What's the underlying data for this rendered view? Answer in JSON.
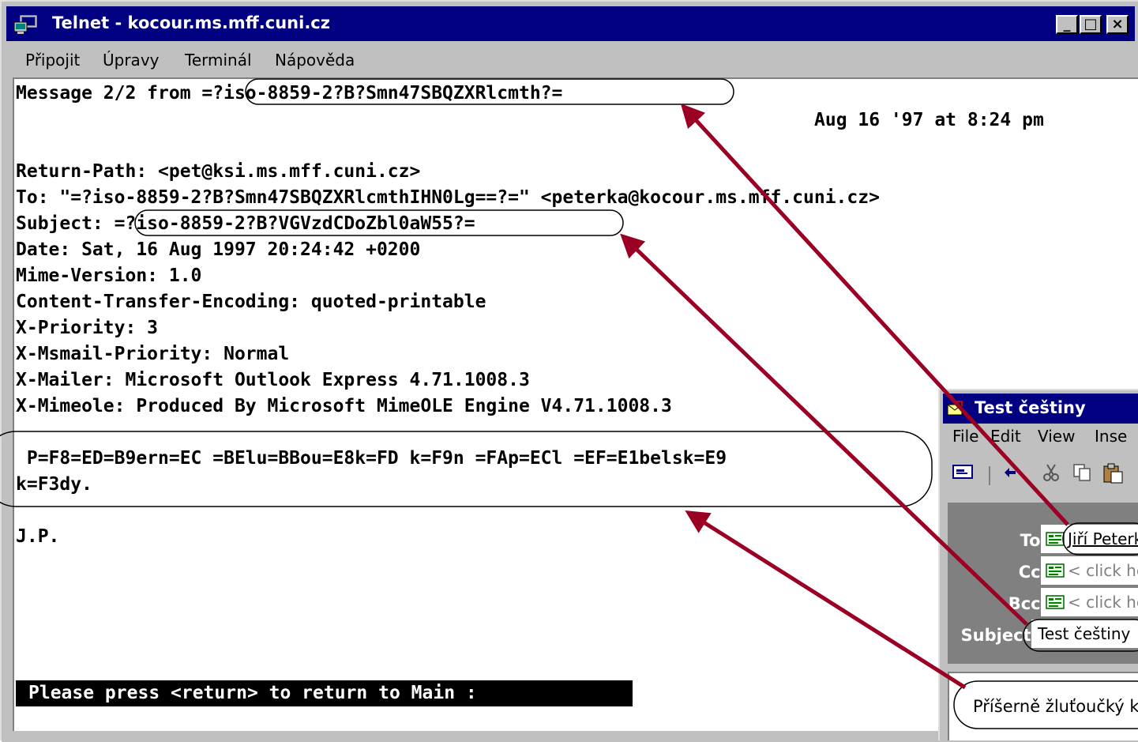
{
  "telnet": {
    "title": "Telnet - kocour.ms.mff.cuni.cz",
    "menu": [
      "Připojit",
      "Úpravy",
      "Terminál",
      "Nápověda"
    ],
    "controls": {
      "minimize": "_",
      "maximize": "□",
      "close": "×"
    },
    "lines": {
      "message": "Message 2/2 from =?iso-8859-2?B?Smn47SBQZXRlcmth?=",
      "date_right": "Aug 16 '97 at 8:24 pm",
      "return_path": "Return-Path: <pet@ksi.ms.mff.cuni.cz>",
      "to": "To: \"=?iso-8859-2?B?Smn47SBQZXRlcmthIHN0Lg==?=\" <peterka@kocour.ms.mff.cuni.cz>",
      "subject": "Subject: =?iso-8859-2?B?VGVzdCDoZbl0aW55?=",
      "date": "Date: Sat, 16 Aug 1997 20:24:42 +0200",
      "mime": "Mime-Version: 1.0",
      "cte": "Content-Transfer-Encoding: quoted-printable",
      "priority": "X-Priority: 3",
      "msmail": "X-Msmail-Priority: Normal",
      "mailer": "X-Mailer: Microsoft Outlook Express 4.71.1008.3",
      "mimeole": "X-Mimeole: Produced By Microsoft MimeOLE Engine V4.71.1008.3",
      "body1": " P=F8=ED=B9ern=EC =BElu=BBou=E8k=FD k=F9n =FAp=ECl =EF=E1belsk=E9",
      "body2": "k=F3dy.",
      "sig": "J.P.",
      "prompt": "Please press <return> to return to Main :"
    }
  },
  "outlook": {
    "title": "Test češtiny",
    "menu": [
      "File",
      "Edit",
      "View",
      "Inse"
    ],
    "labels": {
      "to": "To:",
      "cc": "Cc:",
      "bcc": "Bcc:",
      "subject": "Subject:"
    },
    "to_value": "Jiří Peterk",
    "cc_value": "< click he",
    "bcc_value": "< click he",
    "subject_value": "Test češtiny",
    "body": "Příšerně žluťoučký k"
  },
  "colors": {
    "titlebar": "#000080",
    "chrome": "#c0c0c0",
    "arrow": "#9b0024"
  }
}
